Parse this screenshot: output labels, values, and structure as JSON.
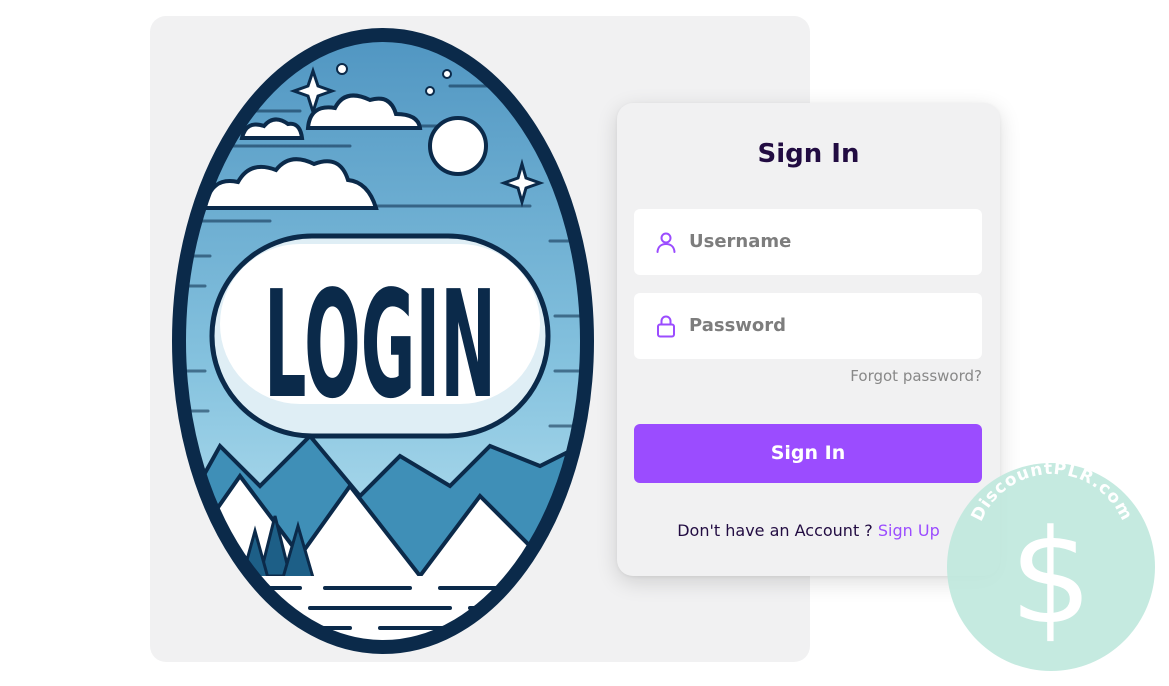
{
  "illustration": {
    "text": "LOGIN",
    "palette": {
      "outline": "#0b2a4a",
      "sky": "#5fa1c8",
      "sky_light": "#bfe3f2",
      "snow": "#ffffff",
      "mountain": "#3f8fb7"
    }
  },
  "signin": {
    "title": "Sign In",
    "username_placeholder": "Username",
    "password_placeholder": "Password",
    "forgot_label": "Forgot password?",
    "button_label": "Sign In",
    "no_account_text": "Don't have an Account ?",
    "signup_label": "Sign Up",
    "user_icon": "user-icon",
    "lock_icon": "lock-icon"
  },
  "watermark": {
    "text": "DiscountPLR.com",
    "symbol": "$",
    "color": "#bfe8dd"
  },
  "colors": {
    "accent": "#9b4cff",
    "title": "#220c42",
    "card": "#f1f1f2",
    "placeholder": "#7d7d7d"
  }
}
